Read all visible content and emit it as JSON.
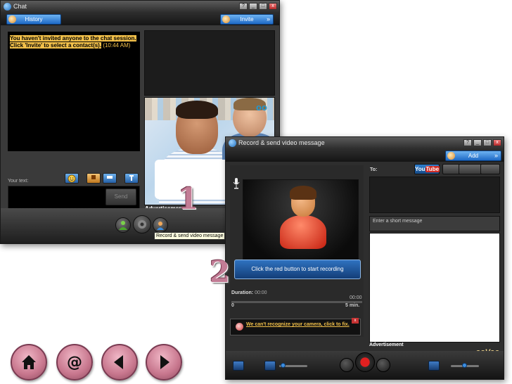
{
  "chat_window": {
    "title": "Chat",
    "tab_history": "History",
    "tab_invite": "Invite",
    "chev": "»",
    "history_message": "You haven't invited anyone to the chat session. Click 'Invite' to select a contact(s).",
    "history_time": "(10:44 AM)",
    "your_text_label": "Your text:",
    "send_label": "Send",
    "advertisement_label": "Advertisement",
    "tooltip": "Record & send video message"
  },
  "record_window": {
    "title": "Record & send video message",
    "tab_add": "Add",
    "chev": "»",
    "to_label": "To:",
    "youtube_you": "You",
    "youtube_tube": "Tube",
    "banner": "Click the red button to start recording",
    "duration_label": "Duration:",
    "duration_value": "00:00",
    "elapsed": "00:00",
    "min_label": "0",
    "max_label": "5 min.",
    "camera_warning": "We can't recognize your camera, click to fix.",
    "message_placeholder": "Enter a short message",
    "advertisement_label": "Advertisement",
    "brand": "ooVoo"
  },
  "markers": {
    "one": "1",
    "two": "2"
  },
  "nav": [
    "home",
    "email",
    "previous",
    "next"
  ],
  "colors": {
    "accent_blue": "#1e69c5",
    "marker_pink": "#c27c95",
    "highlight_yellow": "#f2c04a",
    "record_red": "#e12020"
  }
}
